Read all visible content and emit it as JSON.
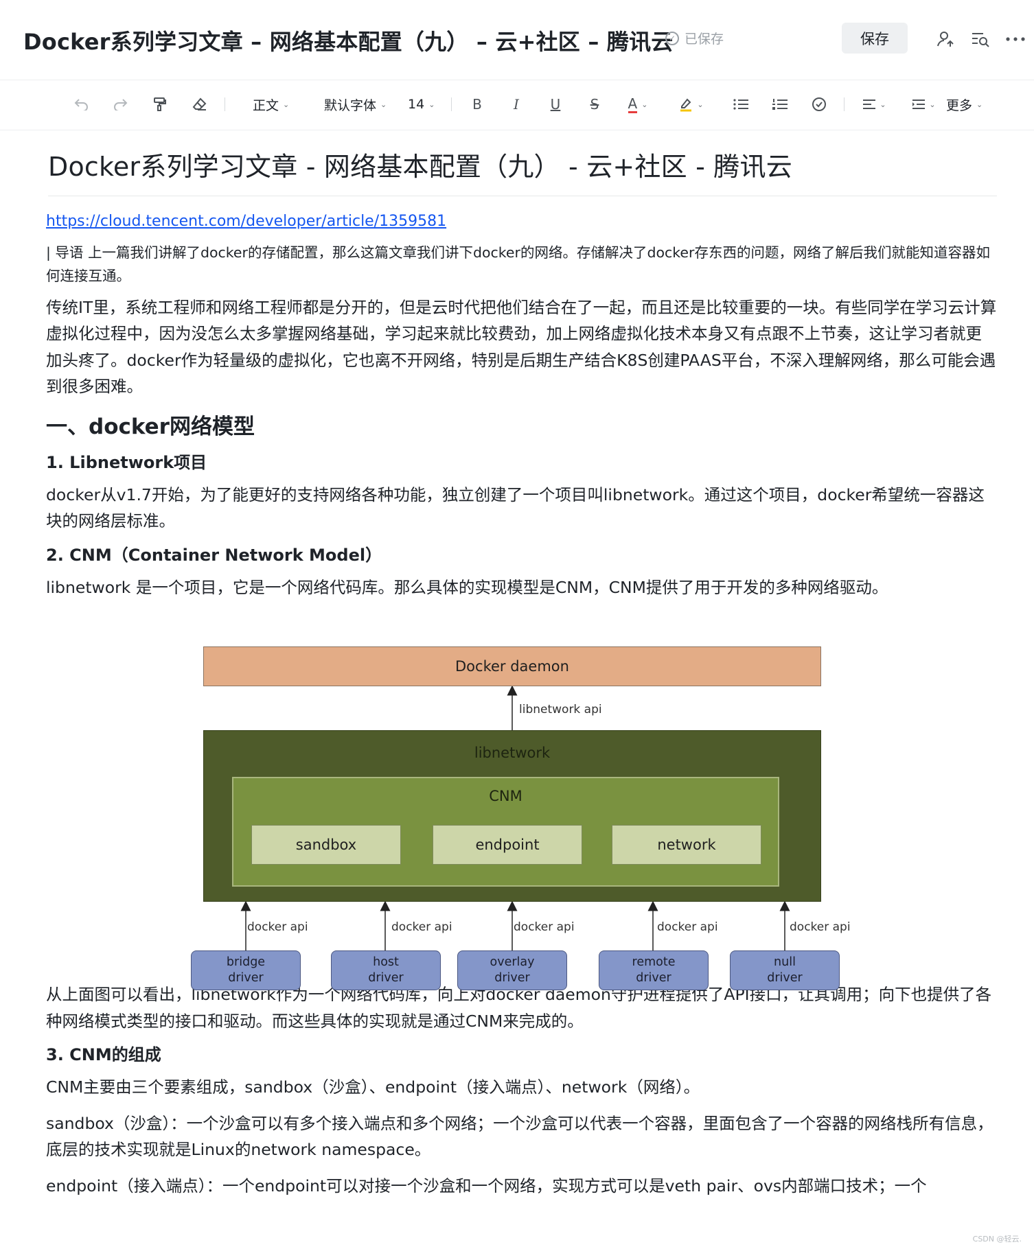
{
  "header": {
    "doc_title": "Docker系列学习文章 – 网络基本配置（九） – 云+社区 – 腾讯云",
    "saved_status": "已保存",
    "save_button": "保存"
  },
  "toolbar": {
    "paragraph_style": "正文",
    "font_family": "默认字体",
    "font_size": "14",
    "bold": "B",
    "italic": "I",
    "underline": "U",
    "strike": "S",
    "font_color": "A",
    "more": "更多",
    "colors": {
      "font_color_bar": "#e63c3c",
      "highlight_bar": "#f5c400"
    }
  },
  "article": {
    "title": "Docker系列学习文章 - 网络基本配置（九） - 云+社区 - 腾讯云",
    "url": "https://cloud.tencent.com/developer/article/1359581",
    "intro": "| 导语 上一篇我们讲解了docker的存储配置，那么这篇文章我们讲下docker的网络。存储解决了docker存东西的问题，网络了解后我们就能知道容器如何连接互通。",
    "para1": "传统IT里，系统工程师和网络工程师都是分开的，但是云时代把他们结合在了一起，而且还是比较重要的一块。有些同学在学习云计算虚拟化过程中，因为没怎么太多掌握网络基础，学习起来就比较费劲，加上网络虚拟化技术本身又有点跟不上节奏，这让学习者就更加头疼了。docker作为轻量级的虚拟化，它也离不开网络，特别是后期生产结合K8S创建PAAS平台，不深入理解网络，那么可能会遇到很多困难。",
    "h2_1": "一、docker网络模型",
    "h3_1": "1. Libnetwork项目",
    "para2": "docker从v1.7开始，为了能更好的支持网络各种功能，独立创建了一个项目叫libnetwork。通过这个项目，docker希望统一容器这块的网络层标准。",
    "h3_2": "2. CNM（Container Network Model）",
    "para3": "libnetwork 是一个项目，它是一个网络代码库。那么具体的实现模型是CNM，CNM提供了用于开发的多种网络驱动。",
    "para4": "从上面图可以看出，libnetwork作为一个网络代码库，向上对docker daemon守护进程提供了API接口，让其调用；向下也提供了各种网络模式类型的接口和驱动。而这些具体的实现就是通过CNM来完成的。",
    "h3_3": "3. CNM的组成",
    "para5": "CNM主要由三个要素组成，sandbox（沙盒）、endpoint（接入端点）、network（网络）。",
    "para6": "sandbox（沙盒）：一个沙盒可以有多个接入端点和多个网络；一个沙盒可以代表一个容器，里面包含了一个容器的网络栈所有信息，底层的技术实现就是Linux的network namespace。",
    "para7": "endpoint（接入端点）：一个endpoint可以对接一个沙盒和一个网络，实现方式可以是veth pair、ovs内部端口技术；一个"
  },
  "diagram": {
    "daemon": "Docker daemon",
    "api_label": "libnetwork api",
    "libnetwork": "libnetwork",
    "cnm": "CNM",
    "components": [
      "sandbox",
      "endpoint",
      "network"
    ],
    "driver_api": [
      "docker api",
      "docker api",
      "docker api",
      "docker api",
      "docker api"
    ],
    "drivers": [
      {
        "line1": "bridge",
        "line2": "driver"
      },
      {
        "line1": "host",
        "line2": "driver"
      },
      {
        "line1": "overlay",
        "line2": "driver"
      },
      {
        "line1": "remote",
        "line2": "driver"
      },
      {
        "line1": "null",
        "line2": "driver"
      }
    ],
    "colors": {
      "daemon": "#e3ac86",
      "libnetwork": "#4e5b2a",
      "cnm": "#7a9240",
      "component": "#cdd6a9",
      "driver": "#8496c9"
    }
  },
  "watermark": "CSDN @轻云."
}
